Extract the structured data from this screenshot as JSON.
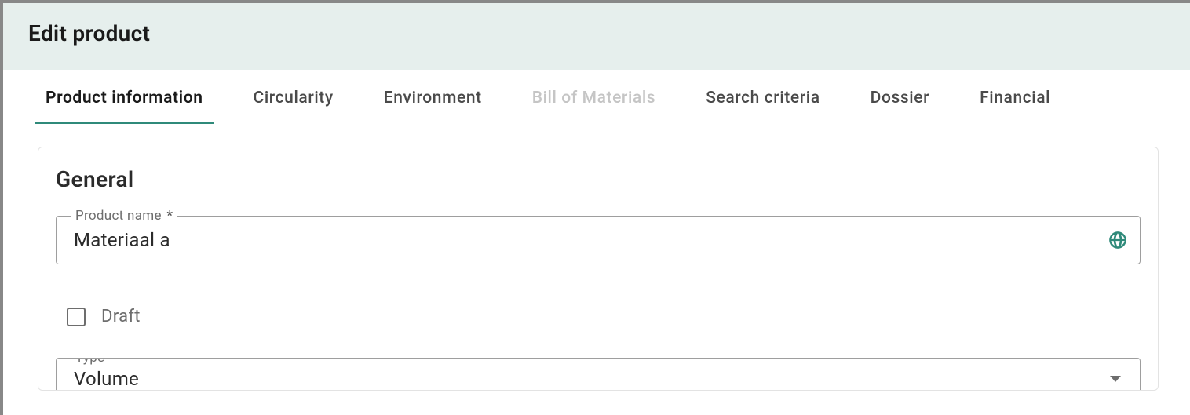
{
  "header": {
    "title": "Edit product"
  },
  "tabs": [
    {
      "label": "Product information",
      "active": true,
      "disabled": false
    },
    {
      "label": "Circularity",
      "active": false,
      "disabled": false
    },
    {
      "label": "Environment",
      "active": false,
      "disabled": false
    },
    {
      "label": "Bill of Materials",
      "active": false,
      "disabled": true
    },
    {
      "label": "Search criteria",
      "active": false,
      "disabled": false
    },
    {
      "label": "Dossier",
      "active": false,
      "disabled": false
    },
    {
      "label": "Financial",
      "active": false,
      "disabled": false
    }
  ],
  "general": {
    "section_title": "General",
    "product_name_label": "Product name",
    "product_name_value": "Materiaal a",
    "draft_label": "Draft",
    "draft_checked": false,
    "type_label": "Type",
    "type_value": "Volume"
  }
}
